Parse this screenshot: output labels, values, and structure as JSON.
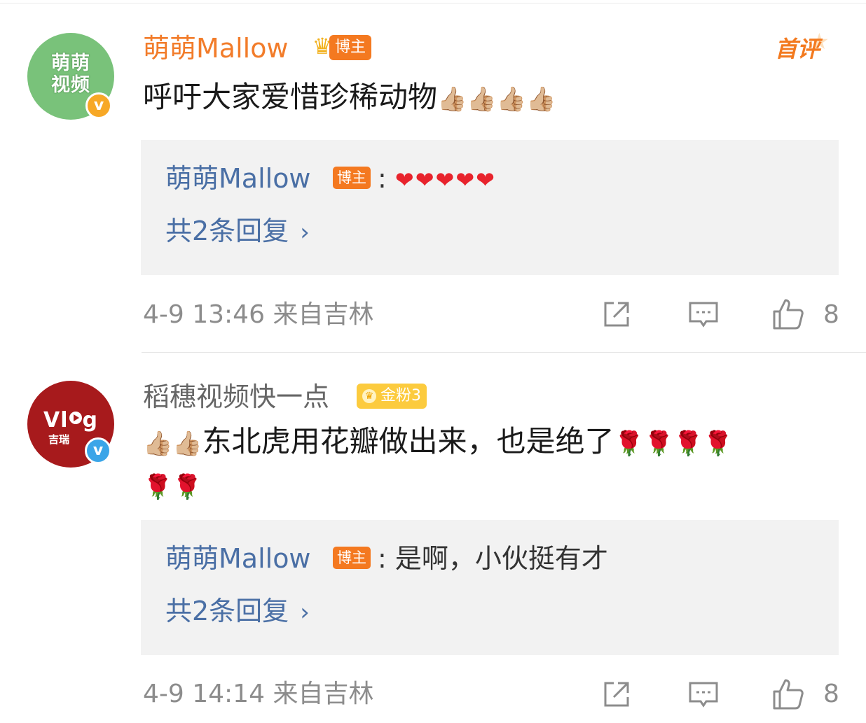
{
  "comments": [
    {
      "avatar_text": "萌萌\n视频",
      "username": "萌萌Mallow",
      "badge": "博主",
      "first_badge": "首评",
      "content": "呼吁大家爱惜珍稀动物",
      "content_emojis": "👍🏼👍🏼👍🏼👍🏼",
      "reply": {
        "user": "萌萌Mallow",
        "badge": "博主",
        "separator": ":",
        "text": "",
        "emojis": "❤❤❤❤❤",
        "more": "共2条回复"
      },
      "time": "4-9 13:46",
      "location": "来自吉林",
      "likes": "8"
    },
    {
      "avatar_main": "Vl",
      "avatar_main_suffix": "g",
      "avatar_sub": "吉瑞",
      "username": "稻穗视频快一点",
      "badge": "金粉3",
      "content_prefix_emojis": "👍🏼👍🏼",
      "content": "东北虎用花瓣做出来，也是绝了",
      "content_emojis": "🌹🌹🌹🌹",
      "content_emojis_line2": "🌹🌹",
      "reply": {
        "user": "萌萌Mallow",
        "badge": "博主",
        "separator": ":",
        "text": "是啊，小伙挺有才",
        "more": "共2条回复"
      },
      "time": "4-9 14:14",
      "location": "来自吉林",
      "likes": "8"
    }
  ],
  "icons": {
    "share": "share-icon",
    "comment": "comment-icon",
    "like": "thumbs-up-icon",
    "verified": "verified-v-icon",
    "crown": "crown-icon",
    "chevron": "chevron-right-icon"
  },
  "colors": {
    "username_orange": "#f27c2a",
    "link_blue": "#4a6fa5",
    "badge_orange": "#f47920",
    "fan_gold": "#fccb3e",
    "meta_gray": "#8c8c8c",
    "reply_bg": "#f2f2f2"
  }
}
